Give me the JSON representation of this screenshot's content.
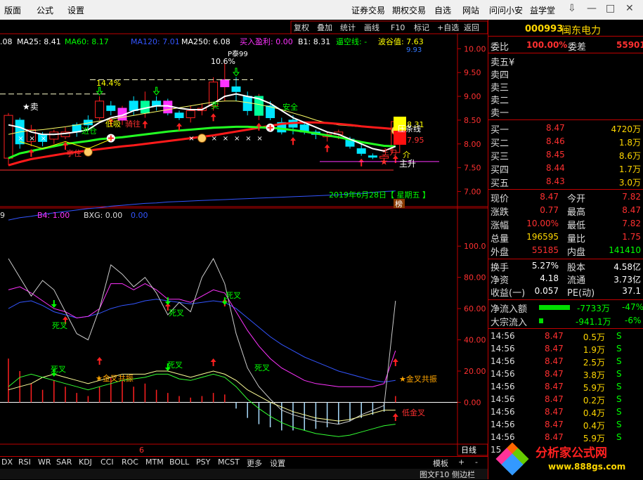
{
  "menu": {
    "left": [
      "版面",
      "公式",
      "设置"
    ],
    "right": [
      "证券交易",
      "期权交易",
      "自选",
      "网站",
      "问问小安",
      "益学堂"
    ]
  },
  "window_controls": {
    "minimize": "—",
    "maximize": "□",
    "close": "✕",
    "pin": "⇩"
  },
  "toolbar": [
    "复权",
    "叠加",
    "统计",
    "画线",
    "F10",
    "标记",
    "+自选",
    "返回"
  ],
  "ma_legend": [
    {
      "text": ".08",
      "color": "#ffffff"
    },
    {
      "text": "MA25: 8.41",
      "color": "#ffffff"
    },
    {
      "text": "MA60: 8.17",
      "color": "#00ff00"
    },
    {
      "text": "MA120: 7.01",
      "color": "#3355ff"
    },
    {
      "text": "MA250: 6.08",
      "color": "#ffffff"
    },
    {
      "text": "买入盈利: 0.00",
      "color": "#ff33ff"
    },
    {
      "text": "B1: 8.31",
      "color": "#ffffff"
    },
    {
      "text": "逼空线: -",
      "color": "#00ff00"
    },
    {
      "text": "波谷值: 7.63",
      "color": "#ffff00"
    }
  ],
  "price_axis": [
    "10.00",
    "9.50",
    "9.00",
    "8.50",
    "8.00",
    "7.50",
    "7.00"
  ],
  "price_tags": {
    "upper": "8.31",
    "lower": "7.95",
    "cut": "9.93"
  },
  "main_annotations": {
    "high_pct": "10.6%",
    "pct2": "14.4%",
    "star_sell": "★卖",
    "sell2": "卖",
    "right_text": "压条线",
    "zhusheng": "主升",
    "zhuli": "主力",
    "jie": "介",
    "date": "2019年6月28日【 星期五 】",
    "bang": "榜",
    "dikou": "低吸",
    "qiwang": "骑往",
    "jincang": "进仓",
    "tingzhu": "亭住",
    "pnote": "P泰99",
    "anwen": "安全"
  },
  "sub_legend": [
    {
      "text": "9",
      "color": "#dddddd"
    },
    {
      "text": "B4: 1.00",
      "color": "#ff33ff"
    },
    {
      "text": "BXG: 0.00",
      "color": "#dddddd"
    },
    {
      "text": "0.00",
      "color": "#3355ff"
    }
  ],
  "sub_axis": [
    "100.0",
    "80.00",
    "60.00",
    "40.00",
    "20.00",
    "0.00"
  ],
  "sub_annotations": {
    "sicha": "死叉",
    "jincha_resonance": "★金叉共振",
    "xjincha": "★金叉",
    "xiajincha": "低金叉"
  },
  "tab_marker": "6",
  "period": "日线",
  "bottom_tabs": [
    "DX",
    "RSI",
    "WR",
    "SAR",
    "KDJ",
    "CCI",
    "ROC",
    "MTM",
    "BOLL",
    "PSY",
    "MCST",
    "更多",
    "设置"
  ],
  "bottom_right": {
    "template": "模板",
    "plus": "+",
    "minus": "-"
  },
  "statusbar": {
    "f10": "图文F10",
    "sidebar": "侧边栏",
    "extra": "笔"
  },
  "stock": {
    "code": "000993",
    "name": "闽东电力"
  },
  "weibi": {
    "label1": "委比",
    "value1": "100.00%",
    "label2": "委差",
    "value2": "55901"
  },
  "sell_levels": [
    "卖五¥",
    "卖四",
    "卖三",
    "卖二",
    "卖一"
  ],
  "buy_levels": [
    {
      "label": "买一",
      "price": "8.47",
      "vol": "4720万"
    },
    {
      "label": "买二",
      "price": "8.46",
      "vol": "1.8万"
    },
    {
      "label": "买三",
      "price": "8.45",
      "vol": "8.6万"
    },
    {
      "label": "买四",
      "price": "8.44",
      "vol": "1.7万"
    },
    {
      "label": "买五",
      "price": "8.43",
      "vol": "3.0万"
    }
  ],
  "stats": [
    {
      "l1": "现价",
      "v1": "8.47",
      "c1": "#ff3030",
      "l2": "今开",
      "v2": "7.82",
      "c2": "#ff3030"
    },
    {
      "l1": "涨跌",
      "v1": "0.77",
      "c1": "#ff3030",
      "l2": "最高",
      "v2": "8.47",
      "c2": "#ff3030"
    },
    {
      "l1": "涨幅",
      "v1": "10.00%",
      "c1": "#ff3030",
      "l2": "最低",
      "v2": "7.82",
      "c2": "#ff3030"
    },
    {
      "l1": "总量",
      "v1": "196595",
      "c1": "#ffd700",
      "l2": "量比",
      "v2": "1.75",
      "c2": "#ff3030"
    },
    {
      "l1": "外盘",
      "v1": "55185",
      "c1": "#ff3030",
      "l2": "内盘",
      "v2": "141410",
      "c2": "#00ff00"
    }
  ],
  "stats2": [
    {
      "l1": "换手",
      "v1": "5.27%",
      "l2": "股本",
      "v2": "4.58亿"
    },
    {
      "l1": "净资",
      "v1": "4.18",
      "l2": "流通",
      "v2": "3.73亿"
    },
    {
      "l1": "收益(一)",
      "v1": "0.057",
      "l2": "PE(动)",
      "v2": "37.1"
    }
  ],
  "flows": [
    {
      "label": "净流入额",
      "value": "-7733万",
      "pct": "-47%"
    },
    {
      "label": "大宗流入",
      "value": "-941.1万",
      "pct": "-6%"
    }
  ],
  "ticks": [
    {
      "t": "14:56",
      "p": "8.47",
      "v": "0.5万",
      "s": "S"
    },
    {
      "t": "14:56",
      "p": "8.47",
      "v": "1.9万",
      "s": "S"
    },
    {
      "t": "14:56",
      "p": "8.47",
      "v": "2.5万",
      "s": "S"
    },
    {
      "t": "14:56",
      "p": "8.47",
      "v": "3.8万",
      "s": "S"
    },
    {
      "t": "14:56",
      "p": "8.47",
      "v": "5.9万",
      "s": "S"
    },
    {
      "t": "14:56",
      "p": "8.47",
      "v": "0.2万",
      "s": "S"
    },
    {
      "t": "14:56",
      "p": "8.47",
      "v": "0.4万",
      "s": "S"
    },
    {
      "t": "14:56",
      "p": "8.47",
      "v": "0.4万",
      "s": "S"
    },
    {
      "t": "14:56",
      "p": "8.47",
      "v": "5.9万",
      "s": "S"
    },
    {
      "t": "15",
      "p": "",
      "v": "",
      "s": ""
    }
  ],
  "watermark": {
    "site": "分析家公式网",
    "url": "www.888gs.com"
  },
  "chart_data": {
    "type": "candlestick",
    "y_range": [
      6.8,
      10.05
    ],
    "candles": [
      [
        7.7,
        8.6,
        7.55,
        8.65
      ],
      [
        8.5,
        8.0,
        7.9,
        8.55
      ],
      [
        8.05,
        8.3,
        7.95,
        8.4
      ],
      [
        8.2,
        8.05,
        7.95,
        8.25
      ],
      [
        8.1,
        8.25,
        8.0,
        8.3
      ],
      [
        8.15,
        8.25,
        8.1,
        8.35
      ],
      [
        8.4,
        8.25,
        8.15,
        8.45
      ],
      [
        8.5,
        8.4,
        8.3,
        8.6
      ],
      [
        8.55,
        8.9,
        8.5,
        9.0
      ],
      [
        8.8,
        8.7,
        8.6,
        8.9
      ],
      [
        8.5,
        8.75,
        8.4,
        8.8
      ],
      [
        8.9,
        8.7,
        8.6,
        9.0
      ],
      [
        8.65,
        8.9,
        8.55,
        9.1
      ],
      [
        8.9,
        8.8,
        8.7,
        9.0
      ],
      [
        8.9,
        8.65,
        8.6,
        8.95
      ],
      [
        8.65,
        8.55,
        8.5,
        8.7
      ],
      [
        8.55,
        8.7,
        8.45,
        8.8
      ],
      [
        8.7,
        8.75,
        8.6,
        8.85
      ],
      [
        8.8,
        9.3,
        8.7,
        9.4
      ],
      [
        9.2,
        9.35,
        8.9,
        9.7
      ],
      [
        9.2,
        9.1,
        8.9,
        9.4
      ],
      [
        9.0,
        8.7,
        8.6,
        9.1
      ],
      [
        8.6,
        9.0,
        8.5,
        9.05
      ],
      [
        8.8,
        8.55,
        8.5,
        8.9
      ],
      [
        8.45,
        8.25,
        8.2,
        8.55
      ],
      [
        8.5,
        8.35,
        8.2,
        8.6
      ],
      [
        8.4,
        8.25,
        8.2,
        8.45
      ],
      [
        8.25,
        8.2,
        8.1,
        8.3
      ],
      [
        8.15,
        8.2,
        8.05,
        8.25
      ],
      [
        8.2,
        8.25,
        8.1,
        8.3
      ],
      [
        8.1,
        7.95,
        7.9,
        8.15
      ],
      [
        7.9,
        7.8,
        7.75,
        8.0
      ],
      [
        7.75,
        7.72,
        7.68,
        7.8
      ],
      [
        7.7,
        7.74,
        7.65,
        7.78
      ],
      [
        7.82,
        8.47,
        7.82,
        8.47
      ]
    ],
    "ma_short": [
      8.4,
      8.35,
      8.25,
      8.2,
      8.2,
      8.22,
      8.25,
      8.3,
      8.45,
      8.55,
      8.6,
      8.7,
      8.75,
      8.8,
      8.8,
      8.75,
      8.72,
      8.72,
      8.85,
      9.0,
      9.05,
      9.0,
      8.95,
      8.85,
      8.7,
      8.55,
      8.45,
      8.35,
      8.25,
      8.2,
      8.1,
      8.0,
      7.9,
      7.85,
      7.95
    ],
    "ma_green": [
      7.7,
      7.8,
      7.85,
      7.9,
      7.95,
      8.0,
      8.03,
      8.06,
      8.1,
      8.12,
      8.14,
      8.17,
      8.2,
      8.23,
      8.26,
      8.28,
      8.3,
      8.32,
      8.34,
      8.35,
      8.36,
      8.36,
      8.35,
      8.34,
      8.32,
      8.29,
      8.26,
      8.22,
      8.18,
      8.14,
      8.09,
      8.04,
      8.0,
      7.96,
      7.95
    ],
    "ma_red": [
      7.55,
      7.62,
      7.68,
      7.72,
      7.76,
      7.8,
      7.83,
      7.86,
      7.89,
      7.92,
      7.95,
      7.97,
      8.0,
      8.03,
      8.06,
      8.09,
      8.12,
      8.15,
      8.18,
      8.22,
      8.26,
      8.3,
      8.34,
      8.38,
      8.42,
      8.44,
      8.45,
      8.45,
      8.44,
      8.42,
      8.4,
      8.37,
      8.35,
      8.33,
      8.31
    ],
    "ma_blue": [
      6.4,
      6.45,
      6.48,
      6.52,
      6.55,
      6.58,
      6.61,
      6.64,
      6.66,
      6.69,
      6.71,
      6.73,
      6.75,
      6.76,
      6.78,
      6.79,
      6.8,
      6.81,
      6.82,
      6.83,
      6.84,
      6.85,
      6.86,
      6.87,
      6.88,
      6.89,
      6.9,
      6.91,
      6.92,
      6.93,
      6.95,
      6.96,
      6.98,
      7.0,
      7.01
    ],
    "ma_yellow": [
      8.2,
      8.25,
      8.28,
      8.3,
      8.33,
      8.36,
      8.4,
      8.44,
      8.48,
      8.52,
      8.56,
      8.6,
      8.64,
      8.68,
      8.72,
      8.76,
      8.8,
      8.84,
      8.88,
      8.9,
      8.9,
      8.87,
      8.83,
      8.78,
      8.72,
      8.65,
      8.58,
      8.5,
      8.44,
      8.4,
      8.38,
      8.36,
      8.34,
      8.32,
      8.3
    ],
    "sub": {
      "y_range": [
        -25,
        110
      ],
      "gray": [
        92,
        80,
        68,
        78,
        72,
        58,
        44,
        40,
        60,
        88,
        82,
        74,
        80,
        70,
        56,
        64,
        58,
        80,
        92,
        76,
        44,
        22,
        10,
        2,
        -5,
        -8,
        -10,
        -12,
        -13,
        -14,
        -12,
        -8,
        -5,
        -2,
        65
      ],
      "magenta": [
        72,
        74,
        70,
        65,
        60,
        58,
        54,
        55,
        60,
        76,
        76,
        72,
        76,
        72,
        66,
        66,
        64,
        68,
        72,
        70,
        58,
        46,
        36,
        28,
        22,
        18,
        14,
        12,
        11,
        10,
        10,
        10,
        10,
        12,
        33
      ],
      "blue": [
        60,
        64,
        65,
        62,
        58,
        56,
        54,
        55,
        57,
        60,
        62,
        63,
        65,
        66,
        65,
        64,
        63,
        64,
        65,
        64,
        60,
        54,
        48,
        42,
        37,
        33,
        29,
        26,
        23,
        20,
        18,
        16,
        14,
        13,
        14
      ],
      "yellow": [
        8,
        10,
        12,
        16,
        18,
        16,
        14,
        12,
        14,
        16,
        18,
        18,
        18,
        20,
        20,
        18,
        16,
        18,
        20,
        18,
        14,
        8,
        4,
        0,
        -3,
        -6,
        -8,
        -10,
        -11,
        -12,
        -11,
        -9,
        -7,
        -5,
        -5
      ],
      "green": [
        10,
        16,
        18,
        16,
        14,
        12,
        10,
        8,
        10,
        12,
        14,
        15,
        16,
        18,
        18,
        15,
        14,
        16,
        18,
        16,
        10,
        2,
        -4,
        -9,
        -13,
        -16,
        -18,
        -20,
        -21,
        -22,
        -21,
        -19,
        -17,
        -15,
        -14
      ],
      "bars": [
        28,
        20,
        12,
        8,
        14,
        10,
        6,
        4,
        10,
        16,
        14,
        10,
        12,
        8,
        6,
        4,
        3,
        4,
        6,
        5,
        -4,
        -10,
        -14,
        -16,
        -18,
        -18,
        -18,
        -17,
        -16,
        -14,
        -12,
        -10,
        -8,
        -6,
        4
      ]
    }
  }
}
